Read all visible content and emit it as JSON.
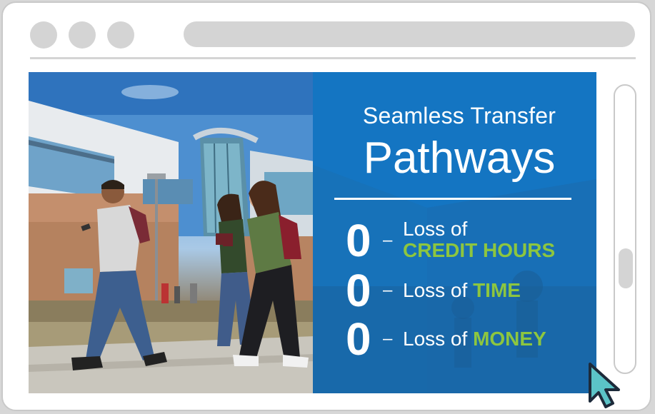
{
  "window": {
    "controls": [
      "close",
      "minimize",
      "maximize"
    ],
    "address_bar": ""
  },
  "banner": {
    "heading_line1": "Seamless Transfer",
    "heading_line2": "Pathways",
    "stats": [
      {
        "number": "0",
        "dash": "–",
        "prefix": "Loss of",
        "highlight": "CREDIT HOURS"
      },
      {
        "number": "0",
        "dash": "–",
        "prefix": "Loss of",
        "highlight": "TIME"
      },
      {
        "number": "0",
        "dash": "–",
        "prefix": "Loss of",
        "highlight": "MONEY"
      }
    ],
    "colors": {
      "panel_blue": "#1479c4",
      "highlight_green": "#8dc63f",
      "text_white": "#ffffff"
    }
  },
  "photo": {
    "subject": "students-walking-on-campus"
  },
  "scrollbar": {
    "icon": "scroll-thumb"
  },
  "cursor": {
    "icon": "pointer-arrow-icon",
    "color": "#5bc3c7"
  }
}
